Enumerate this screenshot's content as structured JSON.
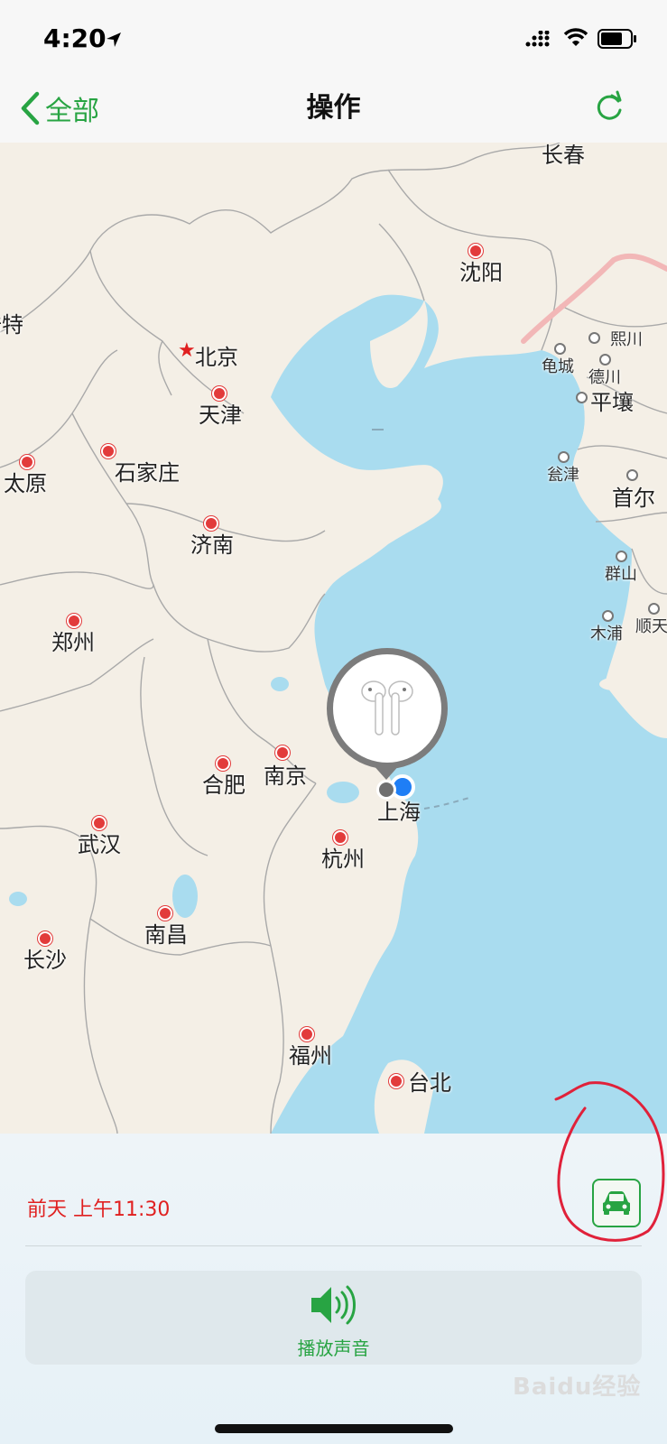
{
  "status_bar": {
    "time": "4:20"
  },
  "nav": {
    "back_label": "全部",
    "title": "操作"
  },
  "map": {
    "cities": [
      {
        "name": "长春"
      },
      {
        "name": "沈阳"
      },
      {
        "name": "北京"
      },
      {
        "name": "天津"
      },
      {
        "name": "石家庄"
      },
      {
        "name": "太原"
      },
      {
        "name": "济南"
      },
      {
        "name": "郑州"
      },
      {
        "name": "合肥"
      },
      {
        "name": "南京"
      },
      {
        "name": "上海"
      },
      {
        "name": "杭州"
      },
      {
        "name": "武汉"
      },
      {
        "name": "南昌"
      },
      {
        "name": "长沙"
      },
      {
        "name": "福州"
      },
      {
        "name": "台北"
      },
      {
        "name": "熙川"
      },
      {
        "name": "龟城"
      },
      {
        "name": "德川"
      },
      {
        "name": "平壤"
      },
      {
        "name": "瓮津"
      },
      {
        "name": "首尔"
      },
      {
        "name": "群山"
      },
      {
        "name": "木浦"
      },
      {
        "name": "顺天"
      },
      {
        "name": "浩特"
      }
    ]
  },
  "device": {
    "icon": "airpods-icon"
  },
  "panel": {
    "timestamp": "前天 上午11:30",
    "play_sound_label": "播放声音",
    "accent_color": "#28a443",
    "timestamp_color": "#e02020"
  },
  "watermark": "Baidu经验"
}
